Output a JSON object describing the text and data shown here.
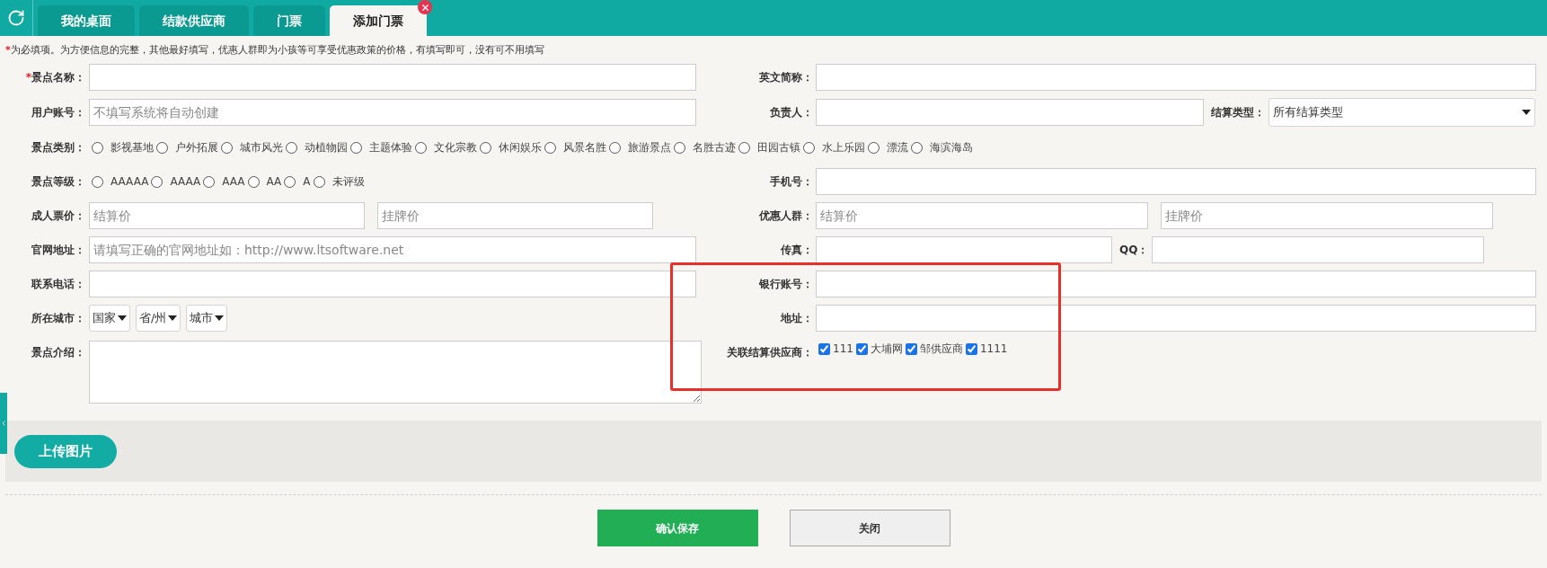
{
  "tabs": [
    {
      "label": "我的桌面",
      "selected": false
    },
    {
      "label": "结款供应商",
      "selected": false
    },
    {
      "label": "门票",
      "selected": false
    },
    {
      "label": "添加门票",
      "selected": true,
      "closable": true
    }
  ],
  "note": {
    "mark": "*",
    "text": "为必填项。为方便信息的完整，其他最好填写，优惠人群即为小孩等可享受优惠政策的价格，有填写即可，没有可不用填写"
  },
  "rows": [
    {
      "cells": [
        {
          "label": "景点名称：",
          "required": true,
          "controls": [
            {
              "kind": "input"
            }
          ]
        },
        {
          "label": "英文简称：",
          "controls": [
            {
              "kind": "input"
            }
          ]
        }
      ]
    },
    {
      "cells": [
        {
          "label": "用户账号：",
          "controls": [
            {
              "kind": "input",
              "placeholder": "不填写系统将自动创建"
            }
          ]
        },
        {
          "label": "负责人：",
          "controls": [
            {
              "kind": "input"
            },
            {
              "kind": "label",
              "text": "结算类型："
            },
            {
              "kind": "select",
              "value": "所有结算类型"
            }
          ]
        }
      ]
    },
    {
      "cells": [
        {
          "label": "景点类别：",
          "controls": [
            {
              "kind": "radio",
              "label": "影视基地",
              "selected": false
            },
            {
              "kind": "radio",
              "label": "户外拓展",
              "selected": false
            },
            {
              "kind": "radio",
              "label": "城市风光",
              "selected": false
            },
            {
              "kind": "radio",
              "label": "动植物园",
              "selected": false
            },
            {
              "kind": "radio",
              "label": "主题体验",
              "selected": false
            },
            {
              "kind": "radio",
              "label": "文化宗教",
              "selected": false
            },
            {
              "kind": "radio",
              "label": "休闲娱乐",
              "selected": false
            },
            {
              "kind": "radio",
              "label": "风景名胜",
              "selected": false
            },
            {
              "kind": "radio",
              "label": "旅游景点",
              "selected": false
            },
            {
              "kind": "radio",
              "label": "名胜古迹",
              "selected": false
            },
            {
              "kind": "radio",
              "label": "田园古镇",
              "selected": false
            },
            {
              "kind": "radio",
              "label": "水上乐园",
              "selected": false
            },
            {
              "kind": "radio",
              "label": "漂流",
              "selected": false
            },
            {
              "kind": "radio",
              "label": "海滨海岛",
              "selected": false
            }
          ]
        }
      ]
    },
    {
      "cells": [
        {
          "label": "景点等级：",
          "controls": [
            {
              "kind": "radio",
              "label": "AAAAA",
              "selected": false
            },
            {
              "kind": "radio",
              "label": "AAAA",
              "selected": false
            },
            {
              "kind": "radio",
              "label": "AAA",
              "selected": false
            },
            {
              "kind": "radio",
              "label": "AA",
              "selected": false
            },
            {
              "kind": "radio",
              "label": "A",
              "selected": false
            },
            {
              "kind": "radio",
              "label": "未评级",
              "selected": false
            }
          ]
        },
        {
          "label": "手机号：",
          "controls": [
            {
              "kind": "input"
            }
          ]
        }
      ]
    },
    {
      "cells": [
        {
          "label": "成人票价：",
          "controls": [
            {
              "kind": "input",
              "placeholder": "结算价"
            },
            {
              "kind": "input",
              "placeholder": "挂牌价"
            }
          ]
        },
        {
          "label": "优惠人群：",
          "controls": [
            {
              "kind": "input",
              "placeholder": "结算价"
            },
            {
              "kind": "input",
              "placeholder": "挂牌价"
            }
          ]
        }
      ]
    },
    {
      "cells": [
        {
          "label": "官网地址：",
          "controls": [
            {
              "kind": "input",
              "placeholder": "请填写正确的官网地址如：http://www.ltsoftware.net"
            }
          ]
        },
        {
          "label": "传真：",
          "controls": [
            {
              "kind": "input"
            },
            {
              "kind": "label",
              "text": "QQ："
            },
            {
              "kind": "input"
            }
          ]
        }
      ]
    },
    {
      "cells": [
        {
          "label": "联系电话：",
          "controls": [
            {
              "kind": "input"
            }
          ]
        },
        {
          "label": "银行账号：",
          "controls": [
            {
              "kind": "input"
            }
          ]
        }
      ]
    },
    {
      "cells": [
        {
          "label": "所在城市：",
          "controls": [
            {
              "kind": "select",
              "value": "国家"
            },
            {
              "kind": "select",
              "value": "省/州"
            },
            {
              "kind": "select",
              "value": "城市"
            }
          ]
        },
        {
          "label": "地址：",
          "controls": [
            {
              "kind": "input"
            }
          ]
        }
      ]
    },
    {
      "cells": [
        {
          "label": "景点介绍：",
          "controls": [
            {
              "kind": "textarea"
            }
          ]
        },
        {
          "label": "关联结算供应商：",
          "controls": [
            {
              "kind": "checkbox",
              "label": "111",
              "checked": true
            },
            {
              "kind": "checkbox",
              "label": "大埔网",
              "checked": true
            },
            {
              "kind": "checkbox",
              "label": "邹供应商",
              "checked": true
            },
            {
              "kind": "checkbox",
              "label": "1111",
              "checked": true
            }
          ]
        }
      ]
    }
  ],
  "upload_button": "上传图片",
  "buttons": [
    {
      "label": "确认保存",
      "kind": "primary"
    },
    {
      "label": "关闭",
      "kind": "secondary"
    }
  ]
}
